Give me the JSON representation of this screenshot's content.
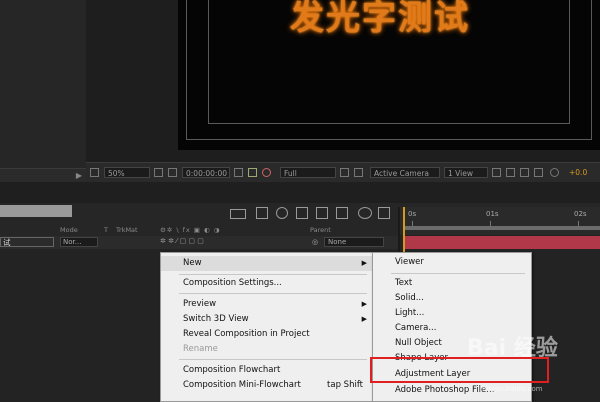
{
  "composition": {
    "preview_text": "发光字测试"
  },
  "viewer_toolbar": {
    "zoom": "50%",
    "timecode": "0:00:00:00",
    "resolution": "Full",
    "camera": "Active Camera",
    "view_layout": "1 View",
    "exposure": "+0.0"
  },
  "timeline": {
    "columns": {
      "mode": "Mode",
      "t": "T",
      "trkmat": "TrkMat",
      "parent": "Parent"
    },
    "layer": {
      "name": "试",
      "mode": "Nor...",
      "parent": "None"
    },
    "ruler": [
      "0s",
      "01s",
      "02s"
    ]
  },
  "context_menu": {
    "items": [
      {
        "label": "New",
        "submenu": true
      },
      {
        "label": "Composition Settings..."
      },
      {
        "label": "Preview",
        "submenu": true
      },
      {
        "label": "Switch 3D View",
        "submenu": true
      },
      {
        "label": "Reveal Composition in Project"
      },
      {
        "label": "Rename",
        "disabled": true
      },
      {
        "label": "Composition Flowchart"
      },
      {
        "label": "Composition Mini-Flowchart",
        "shortcut": "tap Shift"
      }
    ]
  },
  "new_submenu": {
    "items": [
      {
        "label": "Viewer"
      },
      {
        "label": "Text"
      },
      {
        "label": "Solid..."
      },
      {
        "label": "Light..."
      },
      {
        "label": "Camera..."
      },
      {
        "label": "Null Object"
      },
      {
        "label": "Shape Layer"
      },
      {
        "label": "Adjustment Layer"
      },
      {
        "label": "Adobe Photoshop File..."
      }
    ]
  },
  "watermark": {
    "text": "Bai 经验",
    "sub": "jingyan.baidu.com"
  },
  "colors": {
    "accent_orange": "#e07a1a",
    "layer_bar": "#b03848",
    "highlight": "#e02020",
    "playhead": "#d79a1a"
  }
}
